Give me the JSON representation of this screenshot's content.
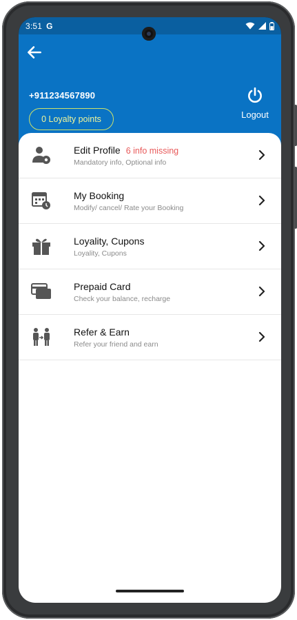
{
  "status": {
    "time": "3:51",
    "g_label": "G"
  },
  "header": {
    "phone": "+911234567890",
    "loyalty": "0 Loyalty points",
    "logout": "Logout"
  },
  "menu": [
    {
      "title": "Edit Profile",
      "badge": "6 info missing",
      "sub": "Mandatory info, Optional info",
      "icon": "user-settings-icon"
    },
    {
      "title": "My Booking",
      "badge": "",
      "sub": "Modify/ cancel/ Rate your Booking",
      "icon": "calendar-booking-icon"
    },
    {
      "title": "Loyality, Cupons",
      "badge": "",
      "sub": "Loyality, Cupons",
      "icon": "gift-icon"
    },
    {
      "title": "Prepaid Card",
      "badge": "",
      "sub": "Check your balance, recharge",
      "icon": "card-icon"
    },
    {
      "title": "Refer & Earn",
      "badge": "",
      "sub": "Refer your friend and earn",
      "icon": "refer-people-icon"
    }
  ],
  "colors": {
    "header": "#0a73c4",
    "statusbar": "#0a5fa0",
    "missing": "#e85a5a",
    "loyalty": "#f0f59a"
  }
}
